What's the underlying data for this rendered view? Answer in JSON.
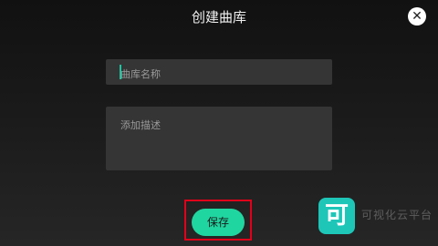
{
  "dialog": {
    "title": "创建曲库",
    "close_icon": "close-icon"
  },
  "form": {
    "name_placeholder": "曲库名称",
    "description_placeholder": "添加描述",
    "save_label": "保存"
  },
  "watermark": {
    "logo_glyph": "可",
    "text": "可视化云平台"
  },
  "colors": {
    "accent": "#20d6a0",
    "highlight_border": "#e2001a",
    "field_bg": "#353535"
  }
}
